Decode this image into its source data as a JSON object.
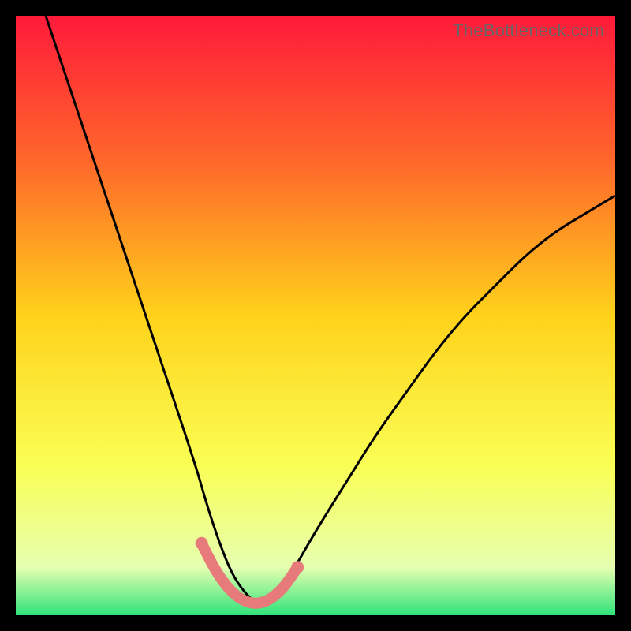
{
  "watermark": "TheBottleneck.com",
  "chart_data": {
    "type": "line",
    "title": "",
    "xlabel": "",
    "ylabel": "",
    "xlim": [
      0,
      100
    ],
    "ylim": [
      0,
      100
    ],
    "gradient_stops": [
      {
        "offset": 0,
        "color": "#ff1a3a"
      },
      {
        "offset": 25,
        "color": "#ff6a2a"
      },
      {
        "offset": 50,
        "color": "#ffd21a"
      },
      {
        "offset": 75,
        "color": "#faff55"
      },
      {
        "offset": 92,
        "color": "#e6ffb0"
      },
      {
        "offset": 100,
        "color": "#2fe37a"
      }
    ],
    "series": [
      {
        "name": "bottleneck-curve",
        "color": "#000000",
        "x": [
          5,
          10,
          15,
          20,
          25,
          30,
          32,
          34,
          36,
          38,
          40,
          42,
          44,
          46,
          50,
          55,
          60,
          65,
          70,
          75,
          80,
          85,
          90,
          95,
          100
        ],
        "y": [
          100,
          85,
          70,
          55,
          40,
          25,
          18,
          12,
          7,
          4,
          2,
          2,
          4,
          7,
          14,
          22,
          30,
          37,
          44,
          50,
          55,
          60,
          64,
          67,
          70
        ]
      },
      {
        "name": "optimal-zone-marker",
        "color": "#e77a7a",
        "x": [
          31,
          33,
          35,
          37,
          39,
          41,
          43,
          45,
          47
        ],
        "y": [
          12,
          8,
          5,
          3,
          2,
          2,
          3,
          5,
          8
        ]
      }
    ]
  }
}
